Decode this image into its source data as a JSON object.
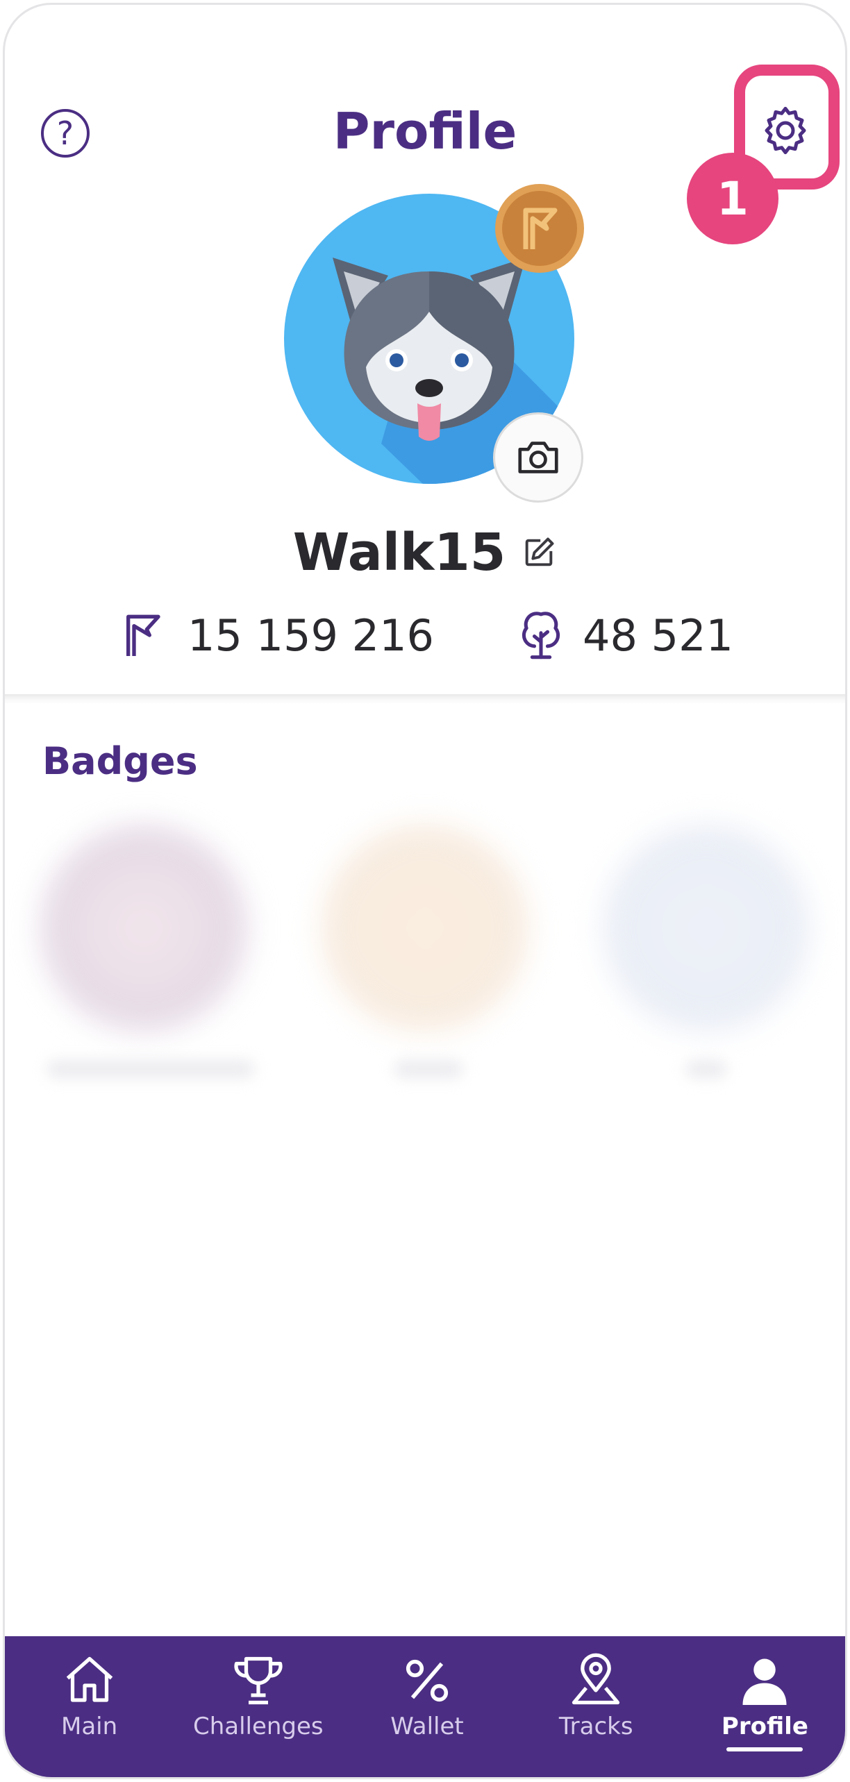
{
  "header": {
    "title": "Profile",
    "help_icon_glyph": "?",
    "step_badge": "1"
  },
  "profile": {
    "avatar_icon": "husky-dog-avatar",
    "level_icon": "bronze-flag-badge",
    "username": "Walk15",
    "distance_value": "15 159 216",
    "trees_value": "48 521"
  },
  "badges": {
    "title": "Badges"
  },
  "nav": {
    "items": [
      {
        "label": "Main",
        "icon": "home-icon"
      },
      {
        "label": "Challenges",
        "icon": "trophy-icon"
      },
      {
        "label": "Wallet",
        "icon": "percent-icon"
      },
      {
        "label": "Tracks",
        "icon": "map-pin-icon"
      },
      {
        "label": "Profile",
        "icon": "person-icon"
      }
    ],
    "active": "Profile"
  },
  "colors": {
    "brand": "#4b2e83",
    "highlight": "#e6457e",
    "avatar_bg": "#4fb7f2",
    "bronze": "#c9823b"
  }
}
